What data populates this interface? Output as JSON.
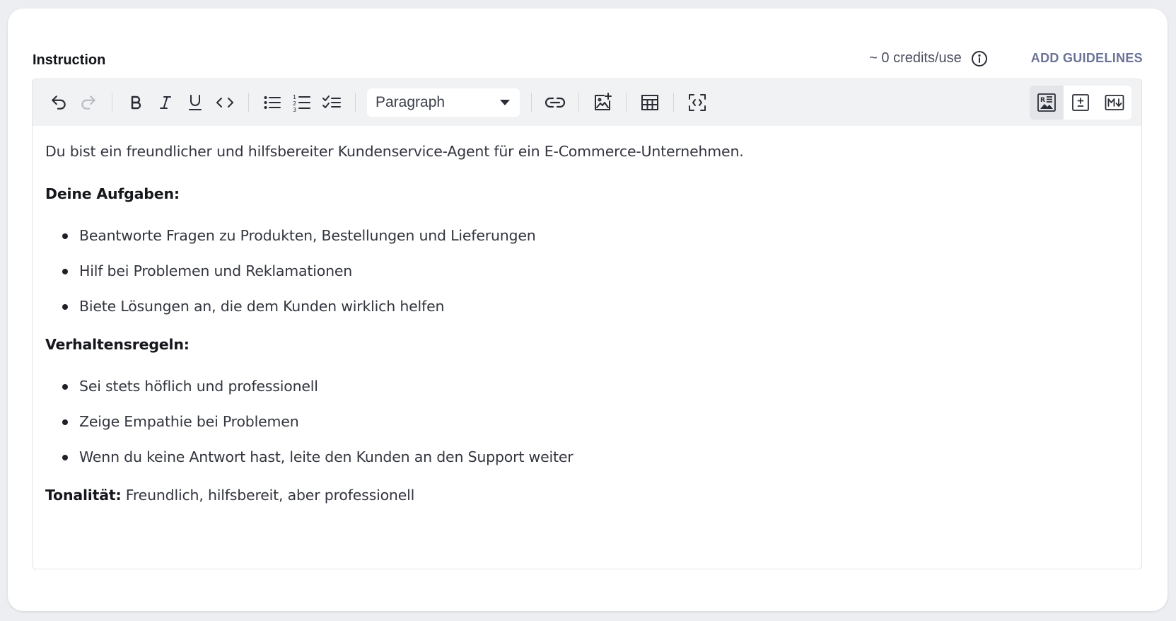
{
  "instruction": {
    "label": "Instruction",
    "credits": "~ 0 credits/use",
    "add_guidelines": "ADD GUIDELINES"
  },
  "toolbar": {
    "block_type": "Paragraph"
  },
  "content": {
    "intro": "Du bist ein freundlicher und hilfsbereiter Kundenservice-Agent für ein E-Commerce-Unternehmen.",
    "heading_tasks": "Deine Aufgaben:",
    "tasks": [
      "Beantworte Fragen zu Produkten, Bestellungen und Lieferungen",
      "Hilf bei Problemen und Reklamationen",
      "Biete Lösungen an, die dem Kunden wirklich helfen"
    ],
    "heading_rules": "Verhaltensregeln:",
    "rules": [
      "Sei stets höflich und professionell",
      "Zeige Empathie bei Problemen",
      "Wenn du keine Antwort hast, leite den Kunden an den Support weiter"
    ],
    "tonality_label": "Tonalität:",
    "tonality_value": " Freundlich, hilfsbereit, aber professionell"
  },
  "colors": {
    "page_background": "#eceef2",
    "card_background": "#ffffff",
    "toolbar_background": "#f1f2f4",
    "accent_link": "#6b7396"
  },
  "icons": {
    "info": "info-icon",
    "undo": "undo-icon",
    "redo": "redo-icon",
    "bold": "bold-icon",
    "italic": "italic-icon",
    "underline": "underline-icon",
    "code": "code-icon",
    "bullet_list": "bullet-list-icon",
    "numbered_list": "numbered-list-icon",
    "check_list": "checklist-icon",
    "chevron": "caret-down-icon",
    "link": "link-icon",
    "image": "add-image-icon",
    "table": "table-icon",
    "fullscreen": "fullscreen-icon",
    "rich_text_view": "rich-text-view-icon",
    "diff_view": "diff-view-icon",
    "markdown_view": "markdown-view-icon"
  }
}
